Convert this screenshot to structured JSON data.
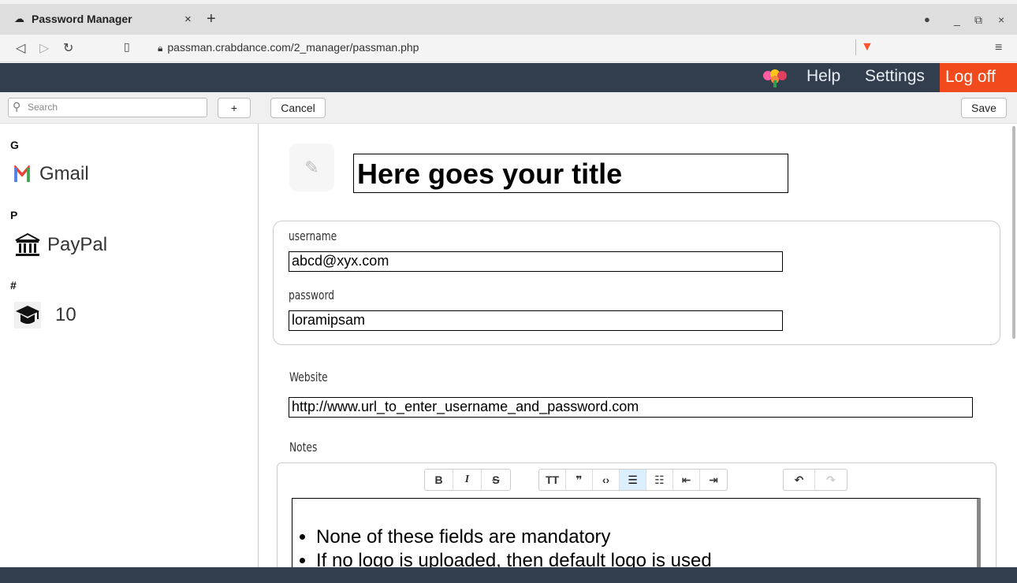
{
  "browser": {
    "tab_title": "Password Manager",
    "tab_close": "×",
    "new_tab": "+",
    "url": "passman.crabdance.com/2_manager/passman.php",
    "win_buttons": [
      "_",
      "⧉",
      "×"
    ]
  },
  "header": {
    "help": "Help",
    "settings": "Settings",
    "logoff": "Log off"
  },
  "toolbar": {
    "search_placeholder": "Search",
    "add_label": "+",
    "cancel_label": "Cancel",
    "save_label": "Save"
  },
  "sidebar": {
    "groups": [
      {
        "letter": "G",
        "entries": [
          {
            "label": "Gmail",
            "icon": "gmail-icon"
          }
        ]
      },
      {
        "letter": "P",
        "entries": [
          {
            "label": "PayPal",
            "icon": "bank-icon"
          }
        ]
      },
      {
        "letter": "#",
        "entries": [
          {
            "label": "10",
            "icon": "graduation-cap-icon"
          }
        ]
      }
    ]
  },
  "form": {
    "title": "Here goes your title",
    "username_label": "username",
    "username": "abcd@xyx.com",
    "password_label": "password",
    "password": "loramipsam",
    "website_label": "Website",
    "website": "http://www.url_to_enter_username_and_password.com",
    "notes_label": "Notes",
    "notes_items": [
      "None of these fields are mandatory",
      "If no logo is uploaded, then default logo is used"
    ]
  },
  "editor_toolbar": {
    "bold": "B",
    "italic": "I",
    "strike": "S",
    "heading": "TT",
    "quote": "❞",
    "code": "‹›",
    "bullet_list": "☰",
    "numbered_list": "☷",
    "outdent": "⇤",
    "indent": "⇥",
    "undo": "↶",
    "redo": "↷"
  },
  "colors": {
    "header_bg": "#323e4d",
    "logoff_bg": "#f14a1c",
    "active_tool": "#dcefff"
  }
}
